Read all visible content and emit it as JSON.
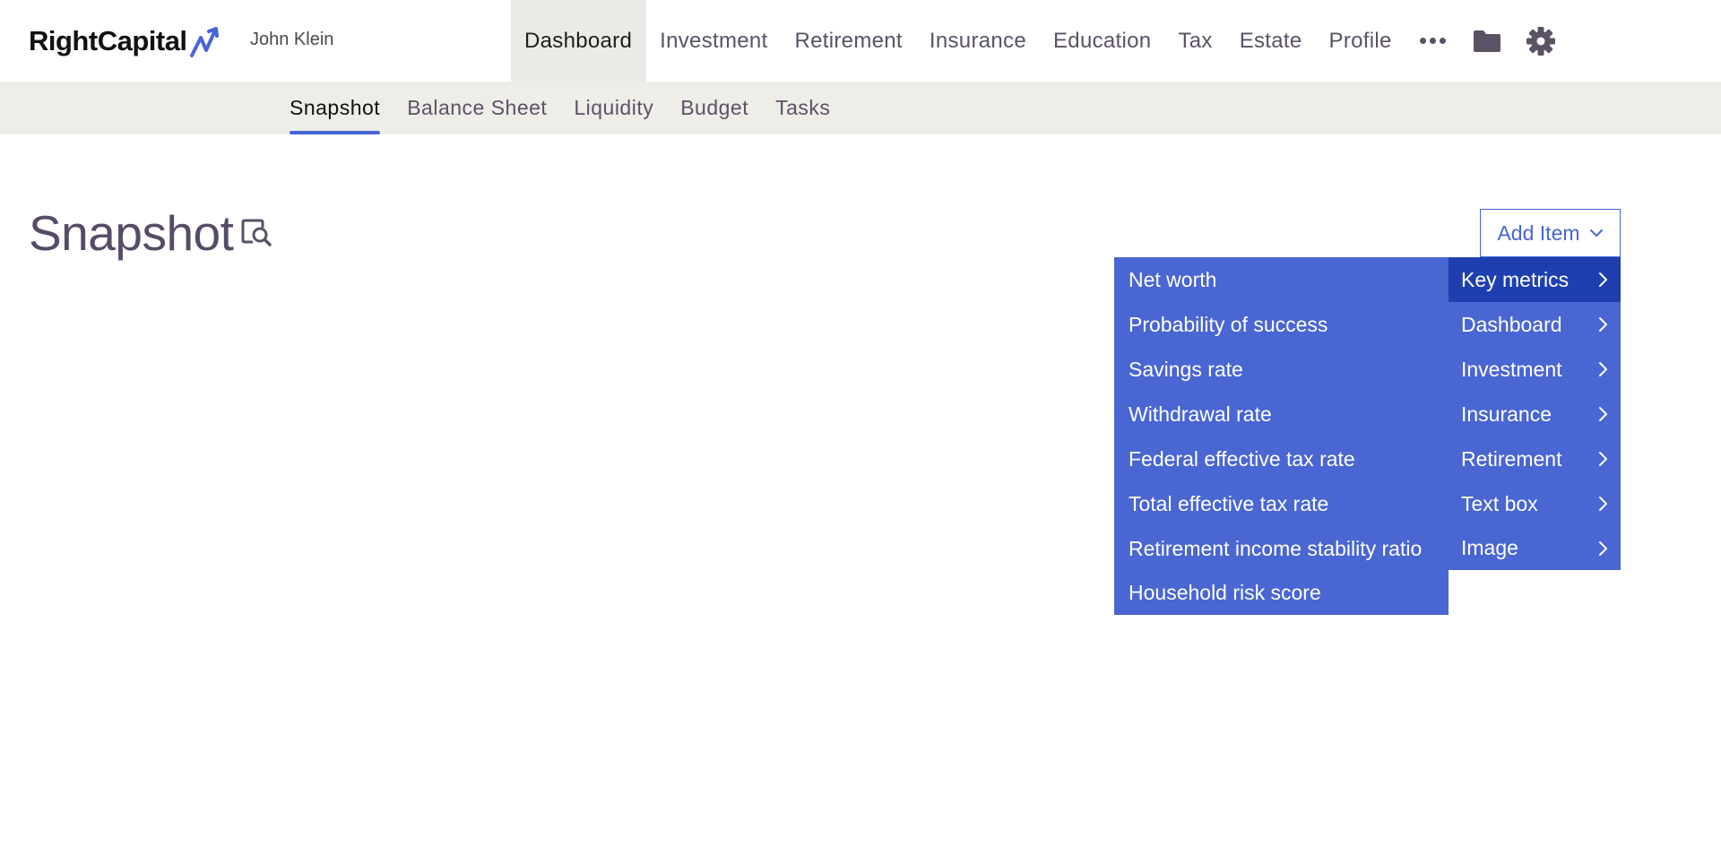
{
  "brand": {
    "name": "RightCapital",
    "accent": "#4765d6",
    "menu_bg": "#4a66d2",
    "menu_active_bg": "#1f3fb0"
  },
  "client": {
    "name": "John Klein"
  },
  "main_nav": {
    "items": [
      "Dashboard",
      "Investment",
      "Retirement",
      "Insurance",
      "Education",
      "Tax",
      "Estate",
      "Profile"
    ],
    "active": "Dashboard",
    "more_icon": "ellipsis-icon",
    "folder_icon": "folder-icon",
    "settings_icon": "gear-icon"
  },
  "sub_nav": {
    "items": [
      "Snapshot",
      "Balance Sheet",
      "Liquidity",
      "Budget",
      "Tasks"
    ],
    "active": "Snapshot"
  },
  "page": {
    "title": "Snapshot",
    "title_icon": "preview-search-icon",
    "add_item_label": "Add Item"
  },
  "add_item_menu": {
    "categories": [
      "Key metrics",
      "Dashboard",
      "Investment",
      "Insurance",
      "Retirement",
      "Text box",
      "Image"
    ],
    "active_category": "Key metrics",
    "key_metrics_items": [
      "Net worth",
      "Probability of success",
      "Savings rate",
      "Withdrawal rate",
      "Federal effective tax rate",
      "Total effective tax rate",
      "Retirement income stability ratio",
      "Household risk score"
    ]
  }
}
